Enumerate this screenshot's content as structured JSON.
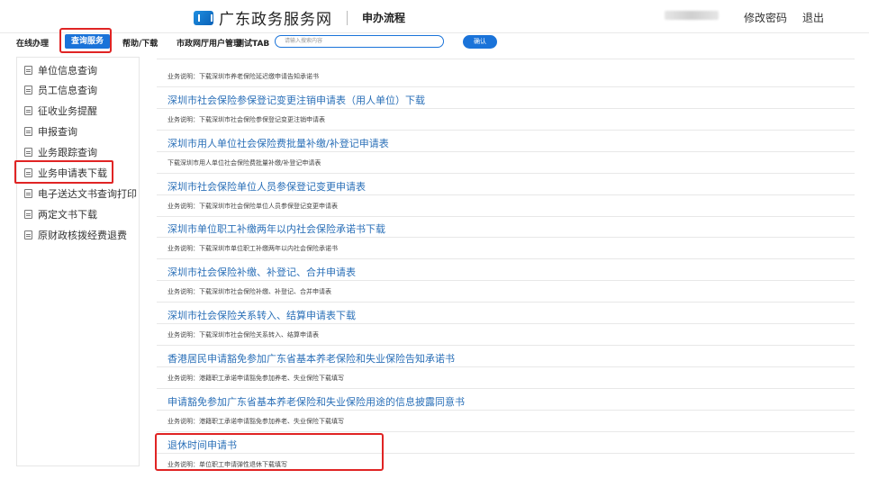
{
  "header": {
    "site_title": "广东政务服务网",
    "sub_title": "申办流程",
    "change_password": "修改密码",
    "logout": "退出"
  },
  "nav": {
    "items": [
      "在线办理",
      "查询服务",
      "帮助/下载",
      "市政网厅用户管理",
      "测试TAB"
    ],
    "search_placeholder": "请输入搜索内容",
    "confirm": "确认"
  },
  "sidebar": {
    "items": [
      "单位信息查询",
      "员工信息查询",
      "征收业务提醒",
      "申报查询",
      "业务跟踪查询",
      "业务申请表下载",
      "电子送达文书查询打印",
      "两定文书下载",
      "原财政核拨经费退费"
    ]
  },
  "entries": [
    {
      "title": "",
      "desc": "业务说明：下载深圳市养老保险延迟缴申请告知承诺书"
    },
    {
      "title": "深圳市社会保险参保登记变更注销申请表（用人单位）下载",
      "desc": "业务说明：下载深圳市社会保险参保登记变更注销申请表"
    },
    {
      "title": "深圳市用人单位社会保险费批量补缴/补登记申请表",
      "desc": "下载深圳市用人单位社会保险费批量补缴/补登记申请表"
    },
    {
      "title": "深圳市社会保险单位人员参保登记变更申请表",
      "desc": "业务说明：下载深圳市社会保险单位人员参保登记变更申请表"
    },
    {
      "title": "深圳市单位职工补缴两年以内社会保险承诺书下载",
      "desc": "业务说明：下载深圳市单位职工补缴两年以内社会保险承诺书"
    },
    {
      "title": "深圳市社会保险补缴、补登记、合并申请表",
      "desc": "业务说明：下载深圳市社会保险补缴、补登记、合并申请表"
    },
    {
      "title": "深圳市社会保险关系转入、结算申请表下载",
      "desc": "业务说明：下载深圳市社会保险关系转入、结算申请表"
    },
    {
      "title": "香港居民申请豁免参加广东省基本养老保险和失业保险告知承诺书",
      "desc": "业务说明：港籍职工承诺申请豁免参加养老、失业保险下载填写"
    },
    {
      "title": "申请豁免参加广东省基本养老保险和失业保险用途的信息披露同意书",
      "desc": "业务说明：港籍职工承诺申请豁免参加养老、失业保险下载填写"
    },
    {
      "title": "退休时间申请书",
      "desc": "业务说明：单位职工申请弹性退休下载填写"
    }
  ]
}
